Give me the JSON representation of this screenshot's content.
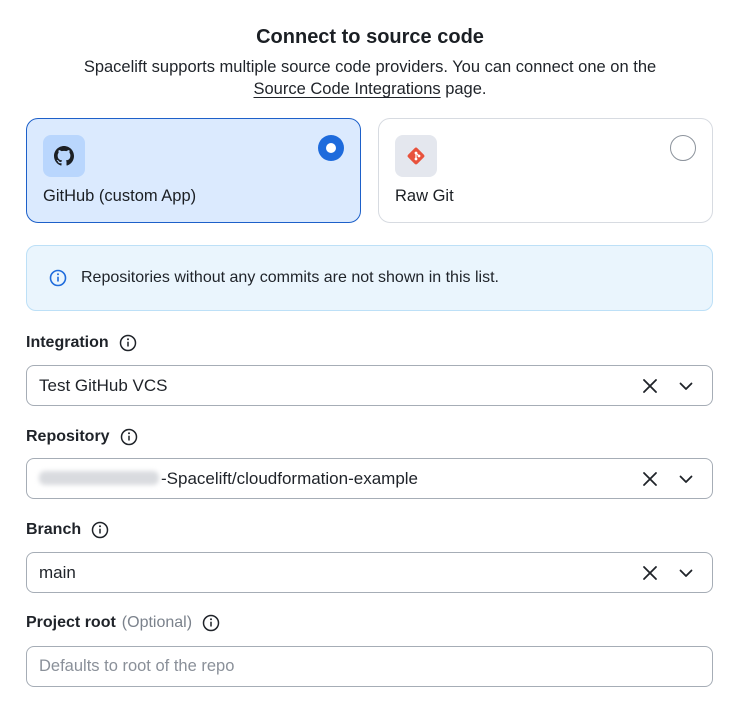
{
  "header": {
    "title": "Connect to source code",
    "subtitle_line1": "Spacelift supports multiple source code providers. You can connect one on the",
    "subtitle_link": "Source Code Integrations",
    "subtitle_after_link": " page."
  },
  "providers": [
    {
      "label": "GitHub (custom App)",
      "icon": "github-icon",
      "selected": true
    },
    {
      "label": "Raw Git",
      "icon": "git-icon",
      "selected": false
    }
  ],
  "info_banner": {
    "icon": "info-circle-icon",
    "text": "Repositories without any commits are not shown in this list."
  },
  "fields": {
    "integration": {
      "label": "Integration",
      "value": "Test GitHub VCS"
    },
    "repository": {
      "label": "Repository",
      "value_suffix": "-Spacelift/cloudformation-example"
    },
    "branch": {
      "label": "Branch",
      "value": "main"
    },
    "project_root": {
      "label": "Project root",
      "optional": "(Optional)",
      "placeholder": "Defaults to root of the repo"
    }
  },
  "colors": {
    "accent": "#1e6bdc",
    "selected_card_bg": "#dbeafe",
    "info_bg": "#eaf5fd",
    "git_brand": "#e8523c"
  }
}
